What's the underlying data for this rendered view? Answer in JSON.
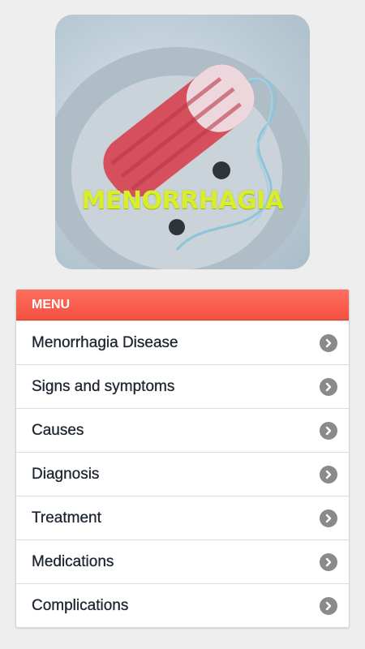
{
  "hero": {
    "title": "MENORRHAGIA"
  },
  "menu": {
    "header": "MENU",
    "items": [
      {
        "label": "Menorrhagia Disease",
        "icon": "chevron-right-icon"
      },
      {
        "label": "Signs and symptoms",
        "icon": "chevron-right-icon"
      },
      {
        "label": "Causes",
        "icon": "chevron-right-icon"
      },
      {
        "label": "Diagnosis",
        "icon": "chevron-right-icon"
      },
      {
        "label": "Treatment",
        "icon": "chevron-right-icon"
      },
      {
        "label": "Medications",
        "icon": "chevron-right-icon"
      },
      {
        "label": "Complications",
        "icon": "chevron-right-icon"
      }
    ]
  },
  "colors": {
    "header": "#f4503f",
    "title_accent": "#d8ee2c",
    "chevron": "#8a8a8a"
  }
}
